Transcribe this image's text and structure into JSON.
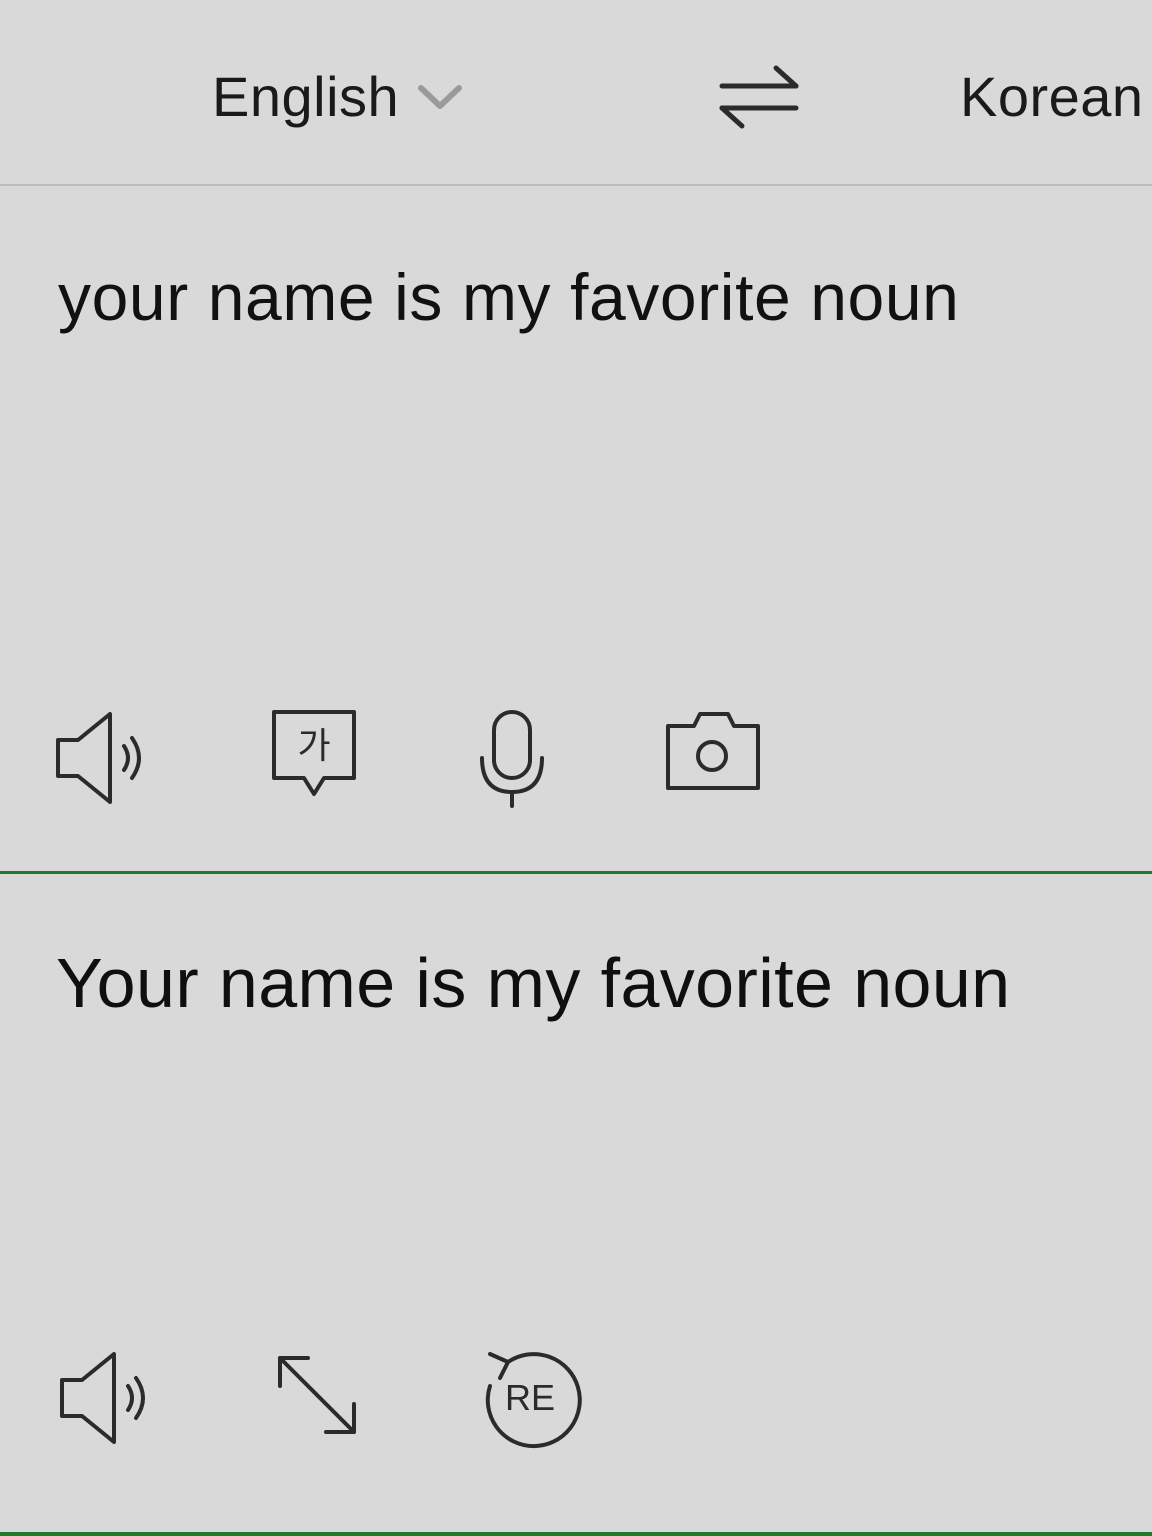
{
  "language_bar": {
    "source_language": "English",
    "target_language": "Korean",
    "icons": {
      "dropdown": "chevron-down-icon",
      "swap": "swap-arrows-icon"
    }
  },
  "source_pane": {
    "text": "your name is my favorite noun",
    "toolbar": {
      "hangul_glyph": "가",
      "icons": [
        "speaker-icon",
        "handwriting-icon",
        "microphone-icon",
        "camera-icon"
      ]
    }
  },
  "result_pane": {
    "text": "Your name is my favorite noun",
    "toolbar": {
      "retranslate_label": "RE",
      "icons": [
        "speaker-icon",
        "expand-icon",
        "retranslate-icon"
      ]
    }
  },
  "colors": {
    "background": "#d9d9d9",
    "divider_accent": "#1f7a2c",
    "icon_stroke": "#2b2b2b",
    "chevron": "#9a9a9a"
  }
}
